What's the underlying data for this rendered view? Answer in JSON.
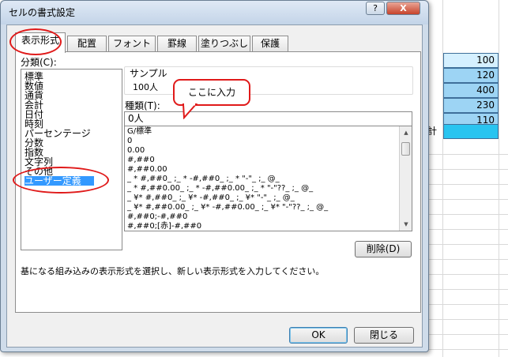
{
  "dialog": {
    "title": "セルの書式設定",
    "help_label": "?",
    "close_label": "X"
  },
  "tabs": [
    {
      "label": "表示形式",
      "active": true
    },
    {
      "label": "配置"
    },
    {
      "label": "フォント"
    },
    {
      "label": "罫線"
    },
    {
      "label": "塗りつぶし"
    },
    {
      "label": "保護"
    }
  ],
  "category": {
    "label": "分類(C):",
    "items": [
      "標準",
      "数値",
      "通貨",
      "会計",
      "日付",
      "時刻",
      "パーセンテージ",
      "分数",
      "指数",
      "文字列",
      "その他",
      "ユーザー定義"
    ],
    "selected": "ユーザー定義"
  },
  "sample": {
    "label": "サンプル",
    "value": "100人"
  },
  "callout": {
    "text": "ここに入力"
  },
  "type": {
    "label": "種類(T):",
    "value": "0人",
    "formats": [
      "G/標準",
      "0",
      "0.00",
      "#,##0",
      "#,##0.00",
      "_ * #,##0_ ;_ * -#,##0_ ;_ * \"-\"_ ;_ @_",
      "_ * #,##0.00_ ;_ * -#,##0.00_ ;_ * \"-\"??_ ;_ @_",
      "_ ¥* #,##0_ ;_ ¥* -#,##0_ ;_ ¥* \"-\"_ ;_ @_",
      "_ ¥* #,##0.00_ ;_ ¥* -#,##0.00_ ;_ ¥* \"-\"??_ ;_ @_",
      "#,##0;-#,##0",
      "#,##0;[赤]-#,##0"
    ]
  },
  "buttons": {
    "delete": "削除(D)",
    "ok": "OK",
    "close": "閉じる"
  },
  "description": "基になる組み込みの表示形式を選択し、新しい表示形式を入力してください。",
  "sheet": {
    "cells": [
      "100",
      "120",
      "400",
      "230",
      "110",
      ""
    ],
    "partial_label": "計"
  },
  "colors": {
    "annotation_red": "#e01a1a",
    "selection_blue": "#3399ff",
    "cell_blue": "#9dd4f4",
    "cell_selected": "#29c4f0"
  }
}
